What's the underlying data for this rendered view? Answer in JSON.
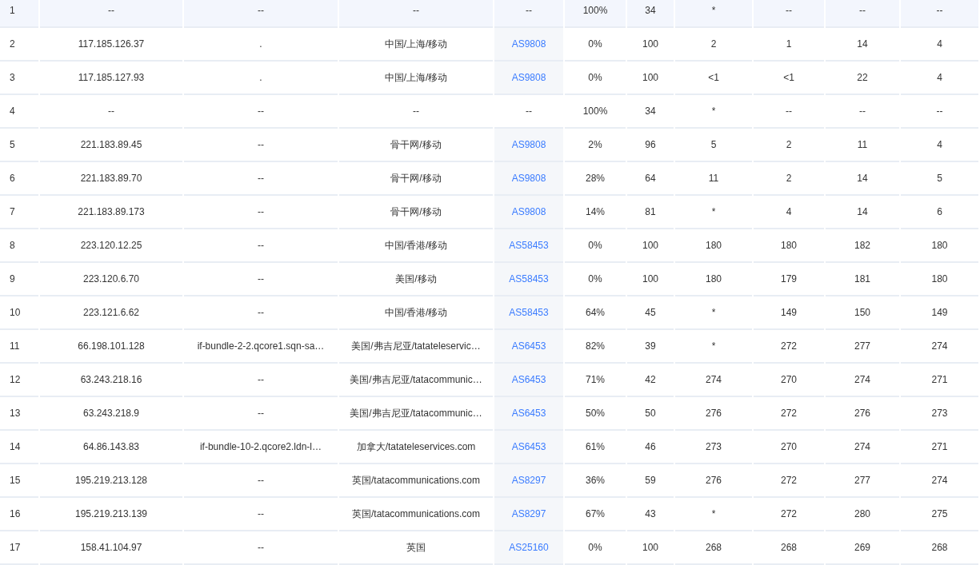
{
  "rows": [
    {
      "selected": true,
      "cells": [
        "1",
        "--",
        "--",
        "--"
      ],
      "asn": {
        "text": "--",
        "link": false
      },
      "stats": [
        "100%",
        "34",
        "*",
        "--",
        "--",
        "--"
      ]
    },
    {
      "selected": false,
      "cells": [
        "2",
        "117.185.126.37",
        ".",
        "中国/上海/移动"
      ],
      "asn": {
        "text": "AS9808",
        "link": true
      },
      "stats": [
        "0%",
        "100",
        "2",
        "1",
        "14",
        "4"
      ]
    },
    {
      "selected": false,
      "cells": [
        "3",
        "117.185.127.93",
        ".",
        "中国/上海/移动"
      ],
      "asn": {
        "text": "AS9808",
        "link": true
      },
      "stats": [
        "0%",
        "100",
        "<1",
        "<1",
        "22",
        "4"
      ]
    },
    {
      "selected": false,
      "cells": [
        "4",
        "--",
        "--",
        "--"
      ],
      "asn": {
        "text": "--",
        "link": false
      },
      "stats": [
        "100%",
        "34",
        "*",
        "--",
        "--",
        "--"
      ]
    },
    {
      "selected": false,
      "cells": [
        "5",
        "221.183.89.45",
        "--",
        "骨干网/移动"
      ],
      "asn": {
        "text": "AS9808",
        "link": true
      },
      "stats": [
        "2%",
        "96",
        "5",
        "2",
        "11",
        "4"
      ]
    },
    {
      "selected": false,
      "cells": [
        "6",
        "221.183.89.70",
        "--",
        "骨干网/移动"
      ],
      "asn": {
        "text": "AS9808",
        "link": true
      },
      "stats": [
        "28%",
        "64",
        "11",
        "2",
        "14",
        "5"
      ]
    },
    {
      "selected": false,
      "cells": [
        "7",
        "221.183.89.173",
        "--",
        "骨干网/移动"
      ],
      "asn": {
        "text": "AS9808",
        "link": true
      },
      "stats": [
        "14%",
        "81",
        "*",
        "4",
        "14",
        "6"
      ]
    },
    {
      "selected": false,
      "cells": [
        "8",
        "223.120.12.25",
        "--",
        "中国/香港/移动"
      ],
      "asn": {
        "text": "AS58453",
        "link": true
      },
      "stats": [
        "0%",
        "100",
        "180",
        "180",
        "182",
        "180"
      ]
    },
    {
      "selected": false,
      "cells": [
        "9",
        "223.120.6.70",
        "--",
        "美国/移动"
      ],
      "asn": {
        "text": "AS58453",
        "link": true
      },
      "stats": [
        "0%",
        "100",
        "180",
        "179",
        "181",
        "180"
      ]
    },
    {
      "selected": false,
      "cells": [
        "10",
        "223.121.6.62",
        "--",
        "中国/香港/移动"
      ],
      "asn": {
        "text": "AS58453",
        "link": true
      },
      "stats": [
        "64%",
        "45",
        "*",
        "149",
        "150",
        "149"
      ]
    },
    {
      "selected": false,
      "cells": [
        "11",
        "66.198.101.128",
        "if-bundle-2-2.qcore1.sqn-sa…",
        "美国/弗吉尼亚/tatateleservic…"
      ],
      "asn": {
        "text": "AS6453",
        "link": true
      },
      "stats": [
        "82%",
        "39",
        "*",
        "272",
        "277",
        "274"
      ]
    },
    {
      "selected": false,
      "cells": [
        "12",
        "63.243.218.16",
        "--",
        "美国/弗吉尼亚/tatacommunic…"
      ],
      "asn": {
        "text": "AS6453",
        "link": true
      },
      "stats": [
        "71%",
        "42",
        "274",
        "270",
        "274",
        "271"
      ]
    },
    {
      "selected": false,
      "cells": [
        "13",
        "63.243.218.9",
        "--",
        "美国/弗吉尼亚/tatacommunic…"
      ],
      "asn": {
        "text": "AS6453",
        "link": true
      },
      "stats": [
        "50%",
        "50",
        "276",
        "272",
        "276",
        "273"
      ]
    },
    {
      "selected": false,
      "cells": [
        "14",
        "64.86.143.83",
        "if-bundle-10-2.qcore2.ldn-l…",
        "加拿大/tatateleservices.com"
      ],
      "asn": {
        "text": "AS6453",
        "link": true
      },
      "stats": [
        "61%",
        "46",
        "273",
        "270",
        "274",
        "271"
      ]
    },
    {
      "selected": false,
      "cells": [
        "15",
        "195.219.213.128",
        "--",
        "英国/tatacommunications.com"
      ],
      "asn": {
        "text": "AS8297",
        "link": true
      },
      "stats": [
        "36%",
        "59",
        "276",
        "272",
        "277",
        "274"
      ]
    },
    {
      "selected": false,
      "cells": [
        "16",
        "195.219.213.139",
        "--",
        "英国/tatacommunications.com"
      ],
      "asn": {
        "text": "AS8297",
        "link": true
      },
      "stats": [
        "67%",
        "43",
        "*",
        "272",
        "280",
        "275"
      ]
    },
    {
      "selected": false,
      "cells": [
        "17",
        "158.41.104.97",
        "--",
        "英国"
      ],
      "asn": {
        "text": "AS25160",
        "link": true
      },
      "stats": [
        "0%",
        "100",
        "268",
        "268",
        "269",
        "268"
      ]
    }
  ]
}
